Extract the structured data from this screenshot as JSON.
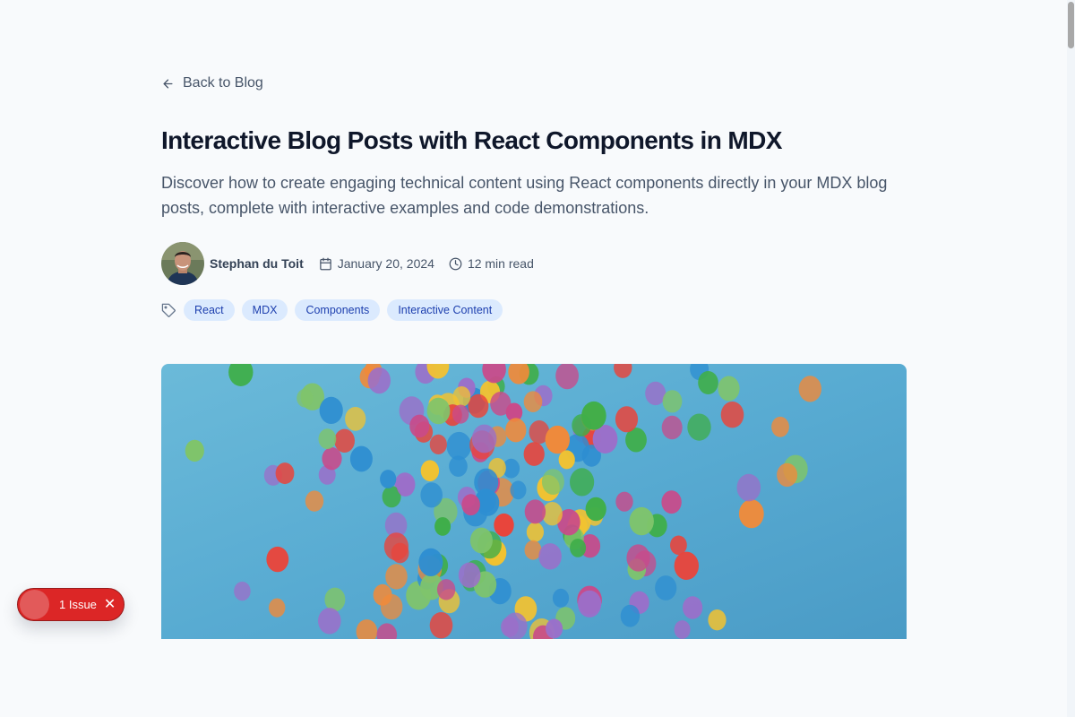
{
  "nav": {
    "back_label": "Back to Blog"
  },
  "post": {
    "title": "Interactive Blog Posts with React Components in MDX",
    "description": "Discover how to create engaging technical content using React components directly in your MDX blog posts, complete with interactive examples and code demonstrations.",
    "author": "Stephan du Toit",
    "date": "January 20, 2024",
    "read_time": "12 min read",
    "tags": [
      "React",
      "MDX",
      "Components",
      "Interactive Content"
    ]
  },
  "issues_badge": {
    "label": "1 Issue"
  },
  "icons": {
    "back": "arrow-left-icon",
    "date": "calendar-icon",
    "read_time": "clock-icon",
    "tags": "tag-icon",
    "close": "close-icon"
  },
  "colors": {
    "tag_bg": "#dbeafe",
    "tag_text": "#1e40af",
    "issue_badge": "#dc2626",
    "hero_sky": "#5aaed4"
  }
}
